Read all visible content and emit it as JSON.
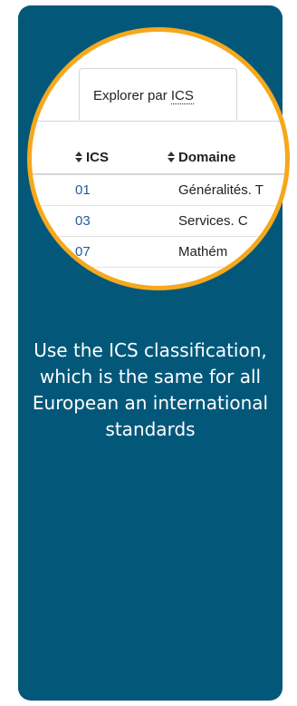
{
  "magnifier": {
    "tab_label_prefix": "Explorer par ",
    "tab_label_link": "ICS",
    "table": {
      "headers": [
        "ICS",
        "Domaine"
      ],
      "rows": [
        {
          "code": "01",
          "domain": "Généralités. T"
        },
        {
          "code": "03",
          "domain": "Services. C"
        },
        {
          "code": "07",
          "domain": "Mathém"
        }
      ]
    }
  },
  "caption": "Use the ICS classification, which is the same for all European an international standards",
  "colors": {
    "card_background": "#03587a",
    "magnifier_border": "#f5a81c",
    "link_text": "#1f5a9e",
    "caption_text": "#ffffff"
  },
  "icons": [
    "sort-icon"
  ]
}
